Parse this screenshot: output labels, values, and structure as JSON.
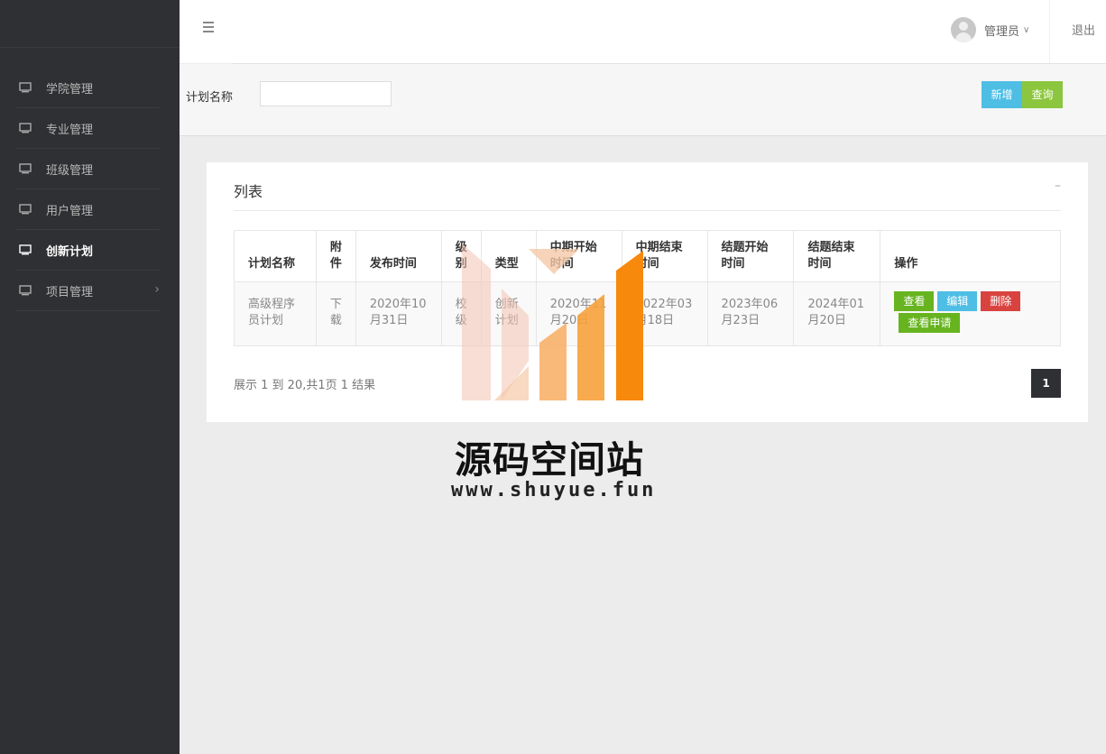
{
  "sidebar": {
    "items": [
      {
        "label": "学院管理",
        "icon": "monitor-icon"
      },
      {
        "label": "专业管理",
        "icon": "monitor-icon"
      },
      {
        "label": "班级管理",
        "icon": "monitor-icon"
      },
      {
        "label": "用户管理",
        "icon": "monitor-icon"
      },
      {
        "label": "创新计划",
        "icon": "monitor-icon",
        "active": true
      },
      {
        "label": "项目管理",
        "icon": "monitor-icon",
        "has_submenu": true
      }
    ]
  },
  "header": {
    "menu_icon": "hamburger-icon",
    "user_name": "管理员",
    "logout_label": "退出"
  },
  "search": {
    "label": "计划名称",
    "value": "",
    "placeholder": "",
    "add_label": "新增",
    "query_label": "查询"
  },
  "panel": {
    "title": "列表",
    "collapse_symbol": "–"
  },
  "table": {
    "headers": [
      "计划名称",
      "附件",
      "发布时间",
      "级别",
      "类型",
      "中期开始时间",
      "中期结束时间",
      "结题开始时间",
      "结题结束时间",
      "操作"
    ],
    "rows": [
      {
        "name": "高级程序员计划",
        "attachment": "下载",
        "publish_time": "2020年10月31日",
        "level": "校级",
        "type": "创新计划",
        "mid_start": "2020年11月20日",
        "mid_end": "2022年03月18日",
        "final_start": "2023年06月23日",
        "final_end": "2024年01月20日",
        "actions": {
          "view": "查看",
          "edit": "编辑",
          "delete": "删除",
          "apply": "查看申请"
        }
      }
    ]
  },
  "pagination": {
    "summary": "展示 1 到 20,共1页 1 结果",
    "current_page": "1"
  },
  "watermark": {
    "title": "源码空间站",
    "url": "www.shuyue.fun"
  },
  "colors": {
    "sidebar_bg": "#2f3033",
    "add_button": "#4ebee5",
    "query_button": "#8cc63f",
    "view_button": "#67b420",
    "delete_button": "#d9433f",
    "watermark_orange": "#f7890c"
  }
}
